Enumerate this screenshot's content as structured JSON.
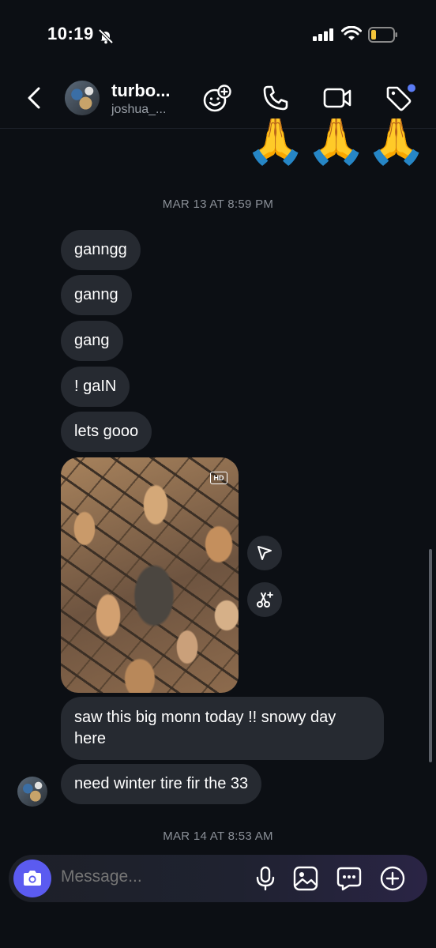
{
  "status_bar": {
    "time": "10:19"
  },
  "header": {
    "name": "turbo...",
    "username": "joshua_..."
  },
  "timestamps": [
    "MAR 13 AT 8:59 PM",
    "MAR 14 AT 8:53 AM"
  ],
  "messages": [
    {
      "text": "ganngg"
    },
    {
      "text": "ganng"
    },
    {
      "text": "gang"
    },
    {
      "text": "! gaIN"
    },
    {
      "text": "lets gooo"
    },
    {
      "text": "saw this big monn today !! snowy day here"
    },
    {
      "text": "need winter tire fir the 33"
    }
  ],
  "photo": {
    "badge": "HD"
  },
  "emoji_row": [
    "🙏",
    "🙏",
    "🙏"
  ],
  "composer": {
    "placeholder": "Message..."
  },
  "colors": {
    "background": "#0c0f14",
    "bubble": "#262a31",
    "camera_button": "#5b5bf0",
    "notification_dot": "#5b7cf5"
  }
}
